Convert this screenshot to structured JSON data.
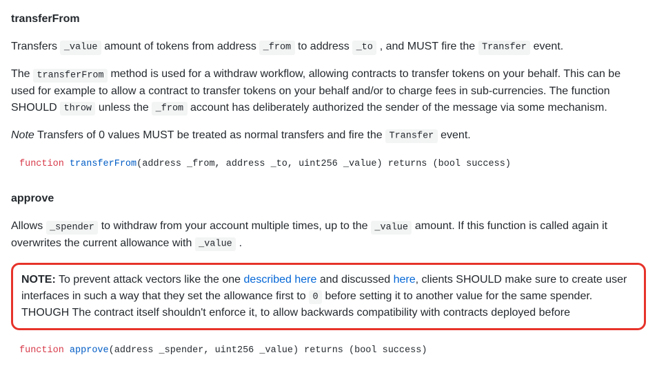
{
  "sections": {
    "transferFrom": {
      "heading": "transferFrom",
      "p1": {
        "t1": "Transfers ",
        "c1": "_value",
        "t2": " amount of tokens from address ",
        "c2": "_from",
        "t3": " to address ",
        "c3": "_to",
        "t4": " , and MUST fire the ",
        "c4": "Transfer",
        "t5": " event."
      },
      "p2": {
        "t1": "The ",
        "c1": "transferFrom",
        "t2": " method is used for a withdraw workflow, allowing contracts to transfer tokens on your behalf. This can be used for example to allow a contract to transfer tokens on your behalf and/or to charge fees in sub-currencies. The function SHOULD ",
        "c2": "throw",
        "t3": " unless the ",
        "c3": "_from",
        "t4": " account has deliberately authorized the sender of the message via some mechanism."
      },
      "p3": {
        "i1": "Note",
        "t1": " Transfers of 0 values MUST be treated as normal transfers and fire the ",
        "c1": "Transfer",
        "t2": " event."
      },
      "code": {
        "kw": "function",
        "fn": "transferFrom",
        "rest": "(address _from, address _to, uint256 _value) returns (bool success)"
      }
    },
    "approve": {
      "heading": "approve",
      "p1": {
        "t1": "Allows ",
        "c1": "_spender",
        "t2": " to withdraw from your account multiple times, up to the ",
        "c2": "_value",
        "t3": " amount. If this function is called again it overwrites the current allowance with ",
        "c3": "_value",
        "t4": " ."
      },
      "note": {
        "b1": "NOTE:",
        "t1": " To prevent attack vectors like the one ",
        "l1": "described here",
        "t2": " and discussed ",
        "l2": "here",
        "t3": ", clients SHOULD make sure to create user interfaces in such a way that they set the allowance first to ",
        "c1": "0",
        "t4": " before setting it to another value for the same spender. THOUGH The contract itself shouldn't enforce it, to allow backwards compatibility with contracts deployed before"
      },
      "code": {
        "kw": "function",
        "fn": "approve",
        "rest": "(address _spender, uint256 _value) returns (bool success)"
      }
    }
  }
}
